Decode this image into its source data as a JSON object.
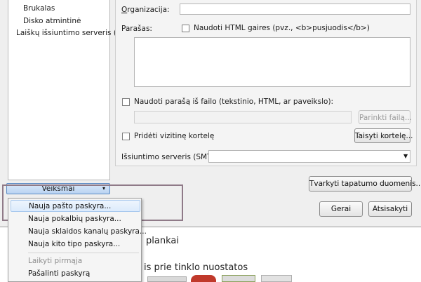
{
  "account_tree": {
    "items": [
      {
        "label": "Brukalas"
      },
      {
        "label": "Disko atmintinė"
      },
      {
        "label": "Laiškų išsiuntimo serveris (S..."
      }
    ]
  },
  "actions_button": {
    "label": "Veiksmai",
    "caret": "▾"
  },
  "settings": {
    "organization_label": "Organizacija:",
    "organization_value": "",
    "signature_label": "Parašas:",
    "html_checkbox_label": "Naudoti HTML gaires (pvz., <b>pusjuodis</b>)",
    "html_checked": false,
    "signature_text": "",
    "file_checkbox_label": "Naudoti parašą iš failo (tekstinio, HTML, ar paveikslo):",
    "file_checked": false,
    "file_path": "",
    "choose_file_button": "Parinkti failą...",
    "vcard_checkbox_label": "Pridėti vizitinę kortelę",
    "vcard_checked": false,
    "edit_card_button": "Taisyti kortelę...",
    "smtp_label": "Išsiuntimo serveris (SMTP):",
    "smtp_value": ""
  },
  "identity_button": "Tvarkyti tapatumo duomenis...",
  "ok_button": "Gerai",
  "cancel_button": "Atsisakyti",
  "menu": {
    "items": [
      {
        "label": "Nauja pašto paskyra...",
        "enabled": true
      },
      {
        "label": "Nauja pokalbių paskyra...",
        "enabled": true
      },
      {
        "label": "Nauja sklaidos kanalų paskyra...",
        "enabled": true
      },
      {
        "label": "Nauja kito tipo paskyra...",
        "enabled": true
      },
      {
        "label": "Laikyti pirmąja",
        "enabled": false
      },
      {
        "label": "Pašalinti paskyrą",
        "enabled": true
      }
    ]
  },
  "background": {
    "text1": "plankai",
    "text2": "is prie tinklo nuostatos"
  }
}
